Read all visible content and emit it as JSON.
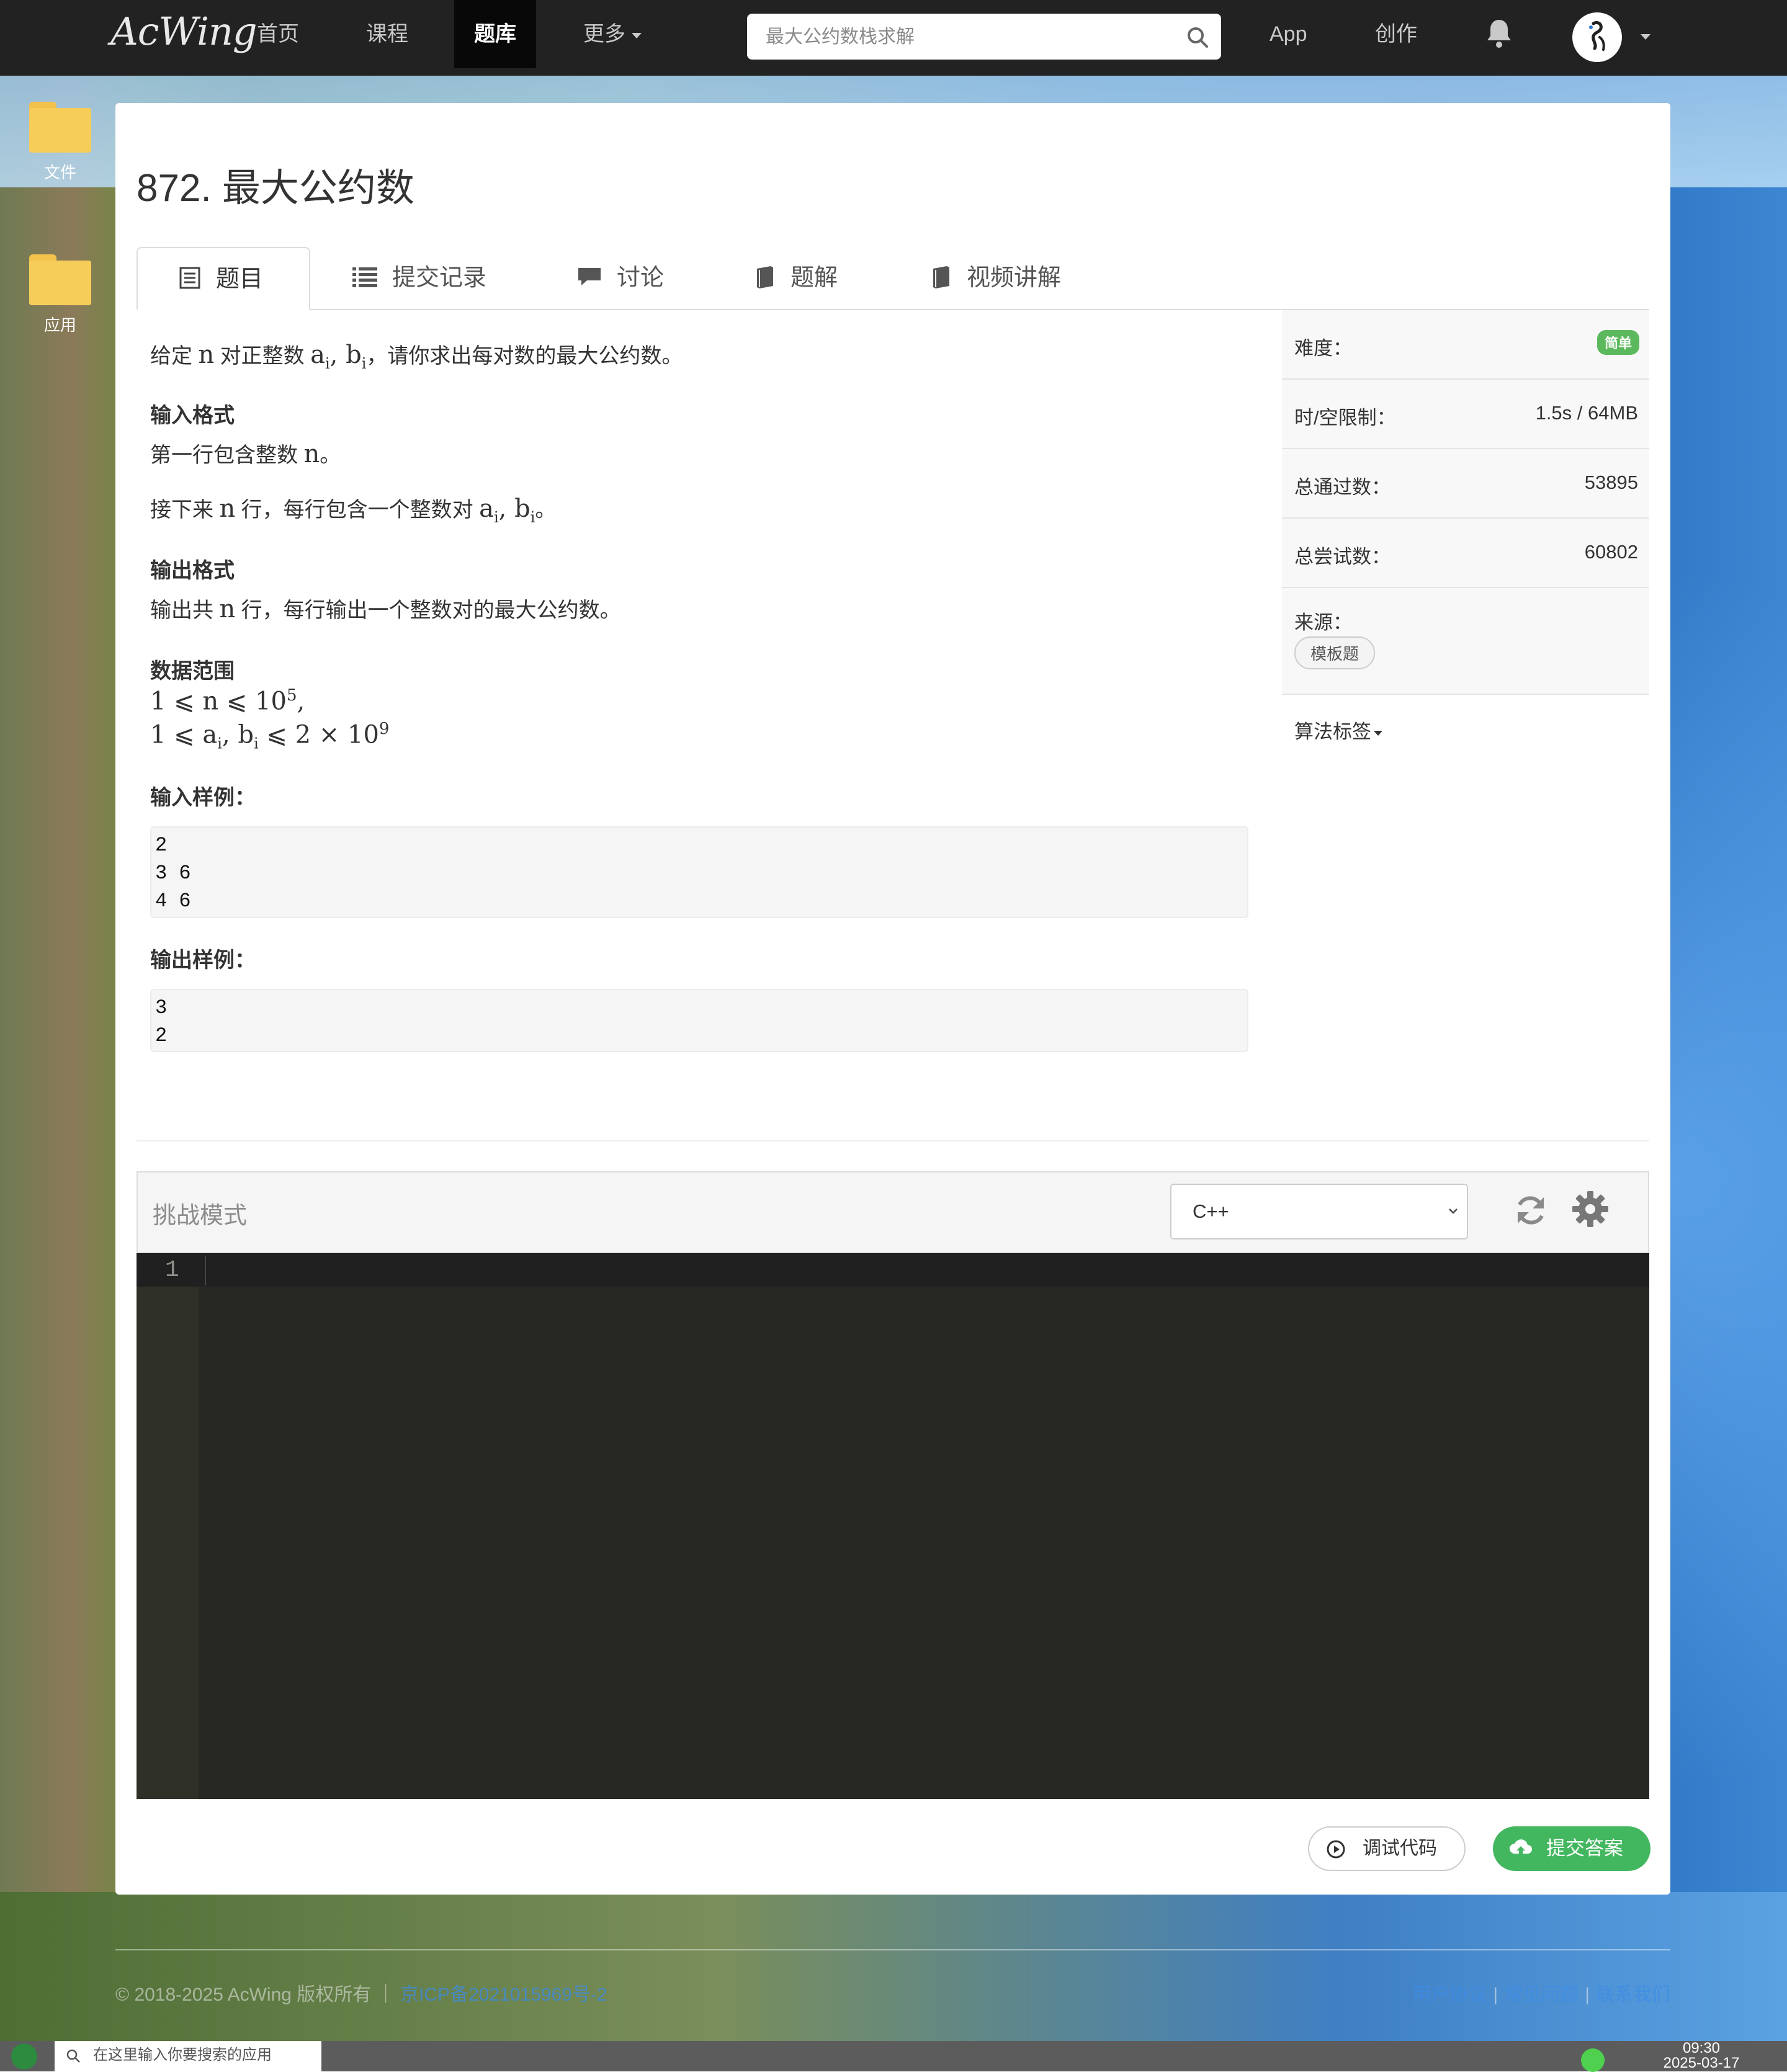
{
  "nav": {
    "logo": "AcWing",
    "items": [
      "首页",
      "课程",
      "题库",
      "更多"
    ],
    "search_placeholder": "最大公约数栈求解",
    "app": "App",
    "create": "创作"
  },
  "desktop": {
    "icons": [
      {
        "label": "文件",
        "icon": "folder-icon"
      },
      {
        "label": "应用",
        "icon": "folder-icon"
      }
    ]
  },
  "problem": {
    "title": "872. 最大公约数",
    "tabs": [
      {
        "label": "题目",
        "icon": "document-icon"
      },
      {
        "label": "提交记录",
        "icon": "list-icon"
      },
      {
        "label": "讨论",
        "icon": "comment-icon"
      },
      {
        "label": "题解",
        "icon": "book-icon"
      },
      {
        "label": "视频讲解",
        "icon": "book-icon"
      }
    ],
    "statement": {
      "intro_pre": "给定",
      "intro_n": "n",
      "intro_mid": "对正整数",
      "intro_post": "，请你求出每对数的最大公约数。",
      "input_heading": "输入格式",
      "input_line1_pre": "第一行包含整数",
      "input_line1_post": "。",
      "input_line2_pre": "接下来",
      "input_line2_mid": "行，每行包含一个整数对",
      "input_line2_post": "。",
      "output_heading": "输出格式",
      "output_line_pre": "输出共",
      "output_line_post": "行，每行输出一个整数对的最大公约数。",
      "range_heading": "数据范围",
      "range_line1": "1 ⩽ n ⩽ 10",
      "range_line1_exp": "5",
      "range_line1_tail": ",",
      "range_line2_pre": "1 ⩽ a",
      "range_line2_mid": ", b",
      "range_line2_post": " ⩽ 2 × 10",
      "range_line2_exp": "9",
      "sub_i": "i",
      "var_a": "a",
      "var_b": "b",
      "sample_input_heading": "输入样例：",
      "sample_input": [
        "2",
        "3 6",
        "4 6"
      ],
      "sample_output_heading": "输出样例：",
      "sample_output": [
        "3",
        "2"
      ]
    },
    "sidebar": {
      "difficulty_label": "难度：",
      "difficulty_value": "简单",
      "limit_label": "时/空限制：",
      "limit_value": "1.5s / 64MB",
      "passed_label": "总通过数：",
      "passed_value": "53895",
      "tried_label": "总尝试数：",
      "tried_value": "60802",
      "source_label": "来源：",
      "source_tag": "模板题",
      "algo_tags_label": "算法标签"
    },
    "editor": {
      "mode": "挑战模式",
      "language": "C++",
      "line_number": "1",
      "debug_button": "调试代码",
      "submit_button": "提交答案"
    }
  },
  "footer": {
    "copyright": "© 2018-2025 AcWing 版权所有 ｜ ",
    "beian": "京ICP备2021015969号-2",
    "links": [
      "用户协议",
      "常见问题",
      "联系我们"
    ]
  },
  "taskbar": {
    "search_placeholder": "在这里输入你要搜索的应用",
    "time": "09:30",
    "date": "2025-03-17"
  },
  "colors": {
    "navbar": "#222222",
    "success": "#5cb85c",
    "submit": "#43b760",
    "editor_bg": "#272822"
  }
}
